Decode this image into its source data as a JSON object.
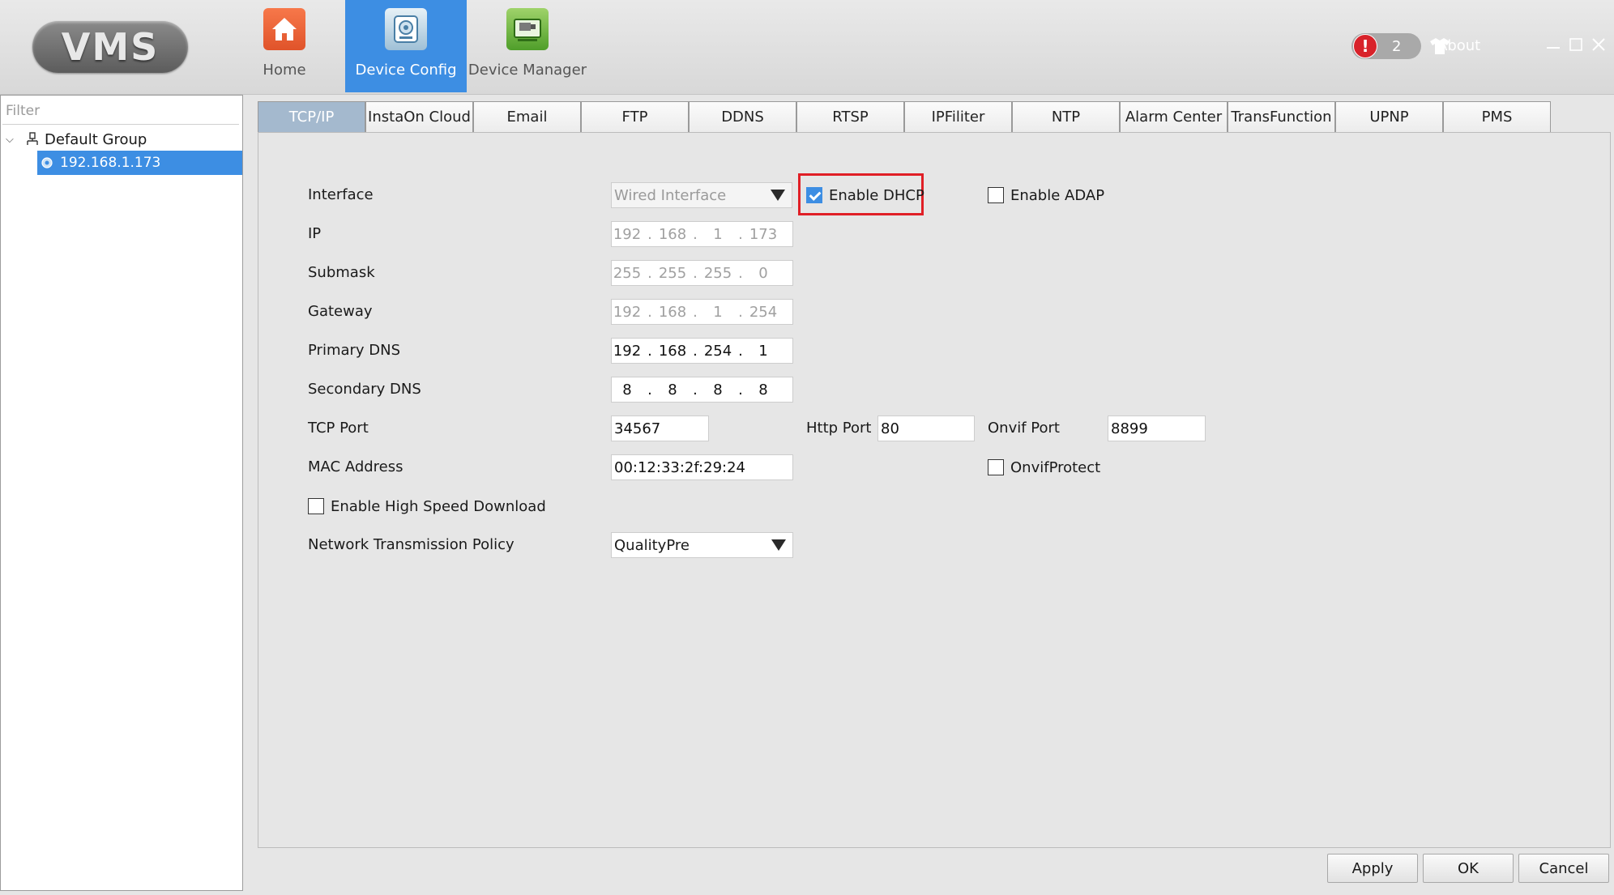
{
  "app": {
    "logo": "VMS"
  },
  "nav": {
    "home": "Home",
    "device_config": "Device Config",
    "device_manager": "Device Manager"
  },
  "header": {
    "alert_count": "2",
    "about": "About"
  },
  "sidebar": {
    "filter_placeholder": "Filter",
    "group": "Default Group",
    "device": "192.168.1.173"
  },
  "tabs": [
    "TCP/IP",
    "InstaOn Cloud",
    "Email",
    "FTP",
    "DDNS",
    "RTSP",
    "IPFiliter",
    "NTP",
    "Alarm Center",
    "TransFunction",
    "UPNP",
    "PMS"
  ],
  "form": {
    "interface_label": "Interface",
    "interface_value": "Wired Interface",
    "enable_dhcp": "Enable DHCP",
    "enable_adap": "Enable ADAP",
    "ip_label": "IP",
    "ip": [
      "192",
      "168",
      "1",
      "173"
    ],
    "submask_label": "Submask",
    "submask": [
      "255",
      "255",
      "255",
      "0"
    ],
    "gateway_label": "Gateway",
    "gateway": [
      "192",
      "168",
      "1",
      "254"
    ],
    "primary_dns_label": "Primary DNS",
    "primary_dns": [
      "192",
      "168",
      "254",
      "1"
    ],
    "secondary_dns_label": "Secondary DNS",
    "secondary_dns": [
      "8",
      "8",
      "8",
      "8"
    ],
    "tcp_port_label": "TCP Port",
    "tcp_port": "34567",
    "http_port_label": "Http Port",
    "http_port": "80",
    "onvif_port_label": "Onvif Port",
    "onvif_port": "8899",
    "mac_label": "MAC Address",
    "mac": "00:12:33:2f:29:24",
    "onvif_protect": "OnvifProtect",
    "high_speed": "Enable High Speed Download",
    "policy_label": "Network Transmission Policy",
    "policy_value": "QualityPre",
    "dhcp_checked": true,
    "adap_checked": false,
    "onvif_protect_checked": false,
    "high_speed_checked": false
  },
  "buttons": {
    "apply": "Apply",
    "ok": "OK",
    "cancel": "Cancel"
  },
  "colors": {
    "accent": "#3d8ee3",
    "highlight": "#e01f26",
    "alert": "#d8222a"
  }
}
